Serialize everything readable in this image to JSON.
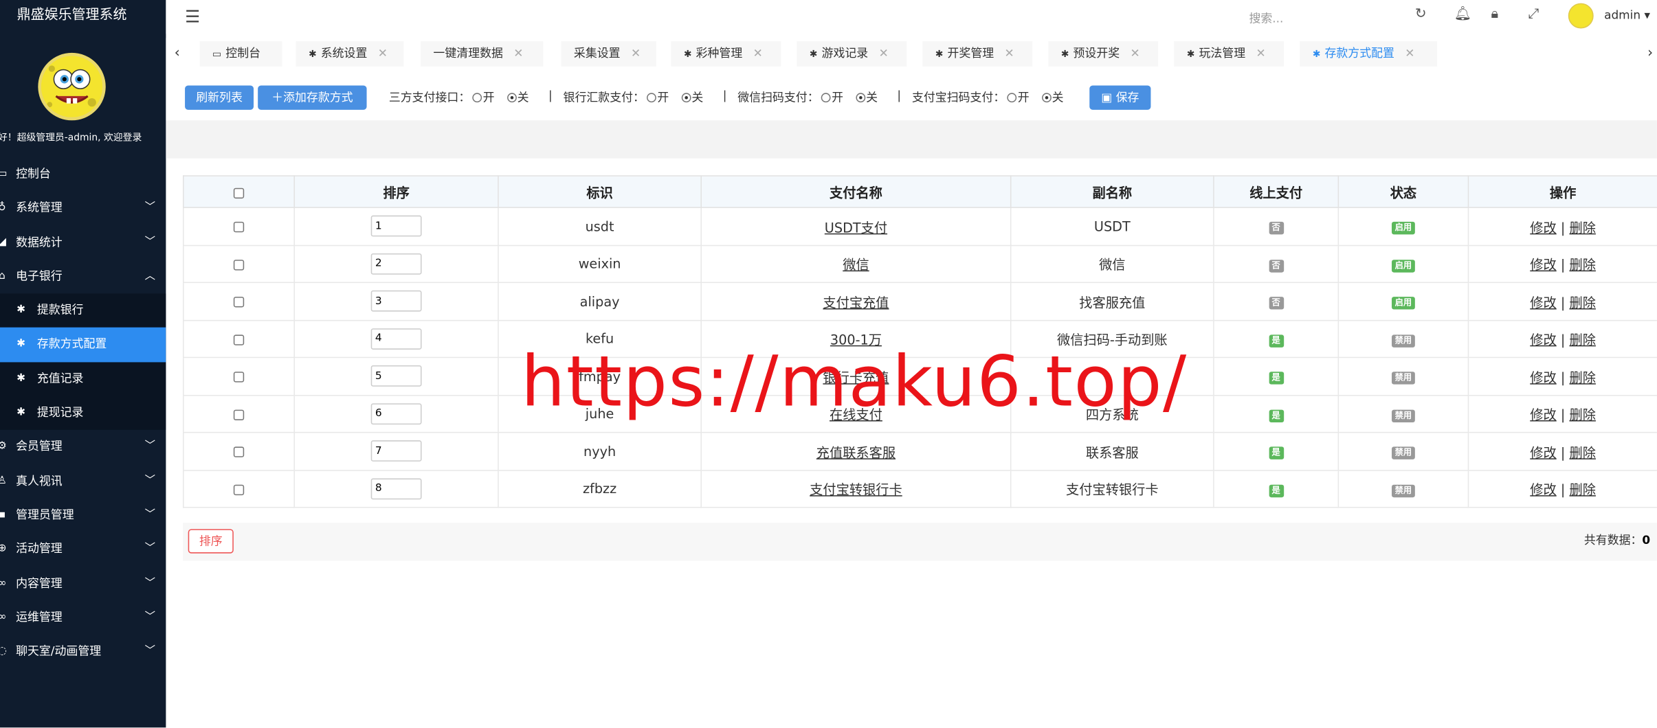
{
  "brand": {
    "title": "鼎盛娱乐管理系统"
  },
  "welcome": "好！超级管理员-admin, 欢迎登录",
  "sidebar": {
    "items": [
      {
        "label": "控制台",
        "icon": "monitor-icon",
        "expandable": false
      },
      {
        "label": "系统管理",
        "icon": "user-icon",
        "expandable": true
      },
      {
        "label": "数据统计",
        "icon": "chart-icon",
        "expandable": true
      },
      {
        "label": "电子银行",
        "icon": "bank-icon",
        "expandable": true,
        "expanded": true
      }
    ],
    "sub_items": [
      {
        "label": "提款银行",
        "icon": "palm-icon"
      },
      {
        "label": "存款方式配置",
        "icon": "palm-icon",
        "active": true
      },
      {
        "label": "充值记录",
        "icon": "palm-icon"
      },
      {
        "label": "提现记录",
        "icon": "palm-icon"
      }
    ],
    "items_after": [
      {
        "label": "会员管理",
        "icon": "gear-icon"
      },
      {
        "label": "真人视讯",
        "icon": "people-icon"
      },
      {
        "label": "管理员管理",
        "icon": "admin-icon"
      },
      {
        "label": "活动管理",
        "icon": "plus-circle-icon"
      },
      {
        "label": "内容管理",
        "icon": "link-icon"
      },
      {
        "label": "运维管理",
        "icon": "link-icon"
      },
      {
        "label": "聊天室/动画管理",
        "icon": "chat-icon"
      }
    ]
  },
  "topbar": {
    "search_placeholder": "搜索...",
    "username": "admin"
  },
  "tabs": [
    {
      "label": "控制台",
      "closable": false
    },
    {
      "label": "系统设置",
      "closable": true
    },
    {
      "label": "一键清理数据",
      "closable": true
    },
    {
      "label": "采集设置",
      "closable": true
    },
    {
      "label": "彩种管理",
      "closable": true
    },
    {
      "label": "游戏记录",
      "closable": true
    },
    {
      "label": "开奖管理",
      "closable": true
    },
    {
      "label": "预设开奖",
      "closable": true
    },
    {
      "label": "玩法管理",
      "closable": true
    },
    {
      "label": "存款方式配置",
      "closable": true,
      "active": true
    }
  ],
  "toolbar": {
    "refresh_label": "刷新列表",
    "add_label": "添加存款方式",
    "save_label": "保存",
    "on_label": "开",
    "off_label": "关",
    "toggles": [
      {
        "label": "三方支付接口：",
        "value": "关"
      },
      {
        "label": "银行汇款支付：",
        "value": "关"
      },
      {
        "label": "微信扫码支付：",
        "value": "关"
      },
      {
        "label": "支付宝扫码支付：",
        "value": "关"
      }
    ]
  },
  "table": {
    "headers": [
      "排序",
      "标识",
      "支付名称",
      "副名称",
      "线上支付",
      "状态",
      "操作"
    ],
    "rows": [
      {
        "sort": "1",
        "code": "usdt",
        "name": "USDT支付",
        "subname": "USDT",
        "online": "否",
        "status": "启用"
      },
      {
        "sort": "2",
        "code": "weixin",
        "name": "微信",
        "subname": "微信",
        "online": "否",
        "status": "启用"
      },
      {
        "sort": "3",
        "code": "alipay",
        "name": "支付宝充值",
        "subname": "找客服充值",
        "online": "否",
        "status": "启用"
      },
      {
        "sort": "4",
        "code": "kefu",
        "name": "300-1万",
        "subname": "微信扫码-手动到账",
        "online": "是",
        "status": "禁用"
      },
      {
        "sort": "5",
        "code": "fmpay",
        "name": "银行卡充值",
        "subname": "",
        "online": "是",
        "status": "禁用"
      },
      {
        "sort": "6",
        "code": "juhe",
        "name": "在线支付",
        "subname": "四方系统",
        "online": "是",
        "status": "禁用"
      },
      {
        "sort": "7",
        "code": "nyyh",
        "name": "充值联系客服",
        "subname": "联系客服",
        "online": "是",
        "status": "禁用"
      },
      {
        "sort": "8",
        "code": "zfbzz",
        "name": "支付宝转银行卡",
        "subname": "支付宝转银行卡",
        "online": "是",
        "status": "禁用"
      }
    ],
    "edit_label": "修改",
    "delete_label": "删除",
    "sep": "|"
  },
  "footer": {
    "sort_label": "排序",
    "total_label": "共有数据：",
    "total_value": "0"
  },
  "watermark": "https://maku6.top/",
  "colors": {
    "sidebar_bg": "#0f1c2e",
    "active_blue": "#2d8cf0",
    "button_blue": "#4a90e2",
    "badge_green": "#5cb85c",
    "badge_gray": "#999999",
    "watermark_red": "#ea1419"
  }
}
